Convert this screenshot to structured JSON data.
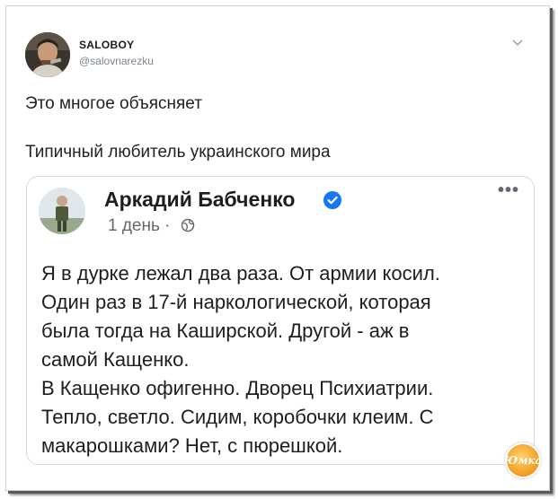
{
  "tweet": {
    "author_name": "SALOBOY",
    "author_handle": "@salovnarezku",
    "text_line1": "Это многое объясняет",
    "text_line2": "Типичный любитель украинского мира",
    "menu_icon": "chevron-down-icon"
  },
  "quoted_post": {
    "author_name": "Аркадий Бабченко",
    "verified_icon": "verified-badge-icon",
    "time": "1 день ·",
    "audience_icon": "globe-icon",
    "more_label": "•••",
    "body_lines": [
      "Я в дурке лежал два раза. От армии косил.",
      "Один раз в 17-й наркологической, которая",
      "была тогда на Каширской. Другой - аж в",
      "самой Кащенко.",
      "В Кащенко офигенно. Дворец Психиатрии.",
      "Тепло, светло. Сидим, коробочки клеим. С",
      "макарошками? Нет, с пюрешкой."
    ]
  },
  "watermark": {
    "text": "Юмка"
  },
  "colors": {
    "verified": "#1877f2",
    "handle": "#7a8590",
    "meta": "#65676b",
    "watermark": "#f29a1f"
  }
}
